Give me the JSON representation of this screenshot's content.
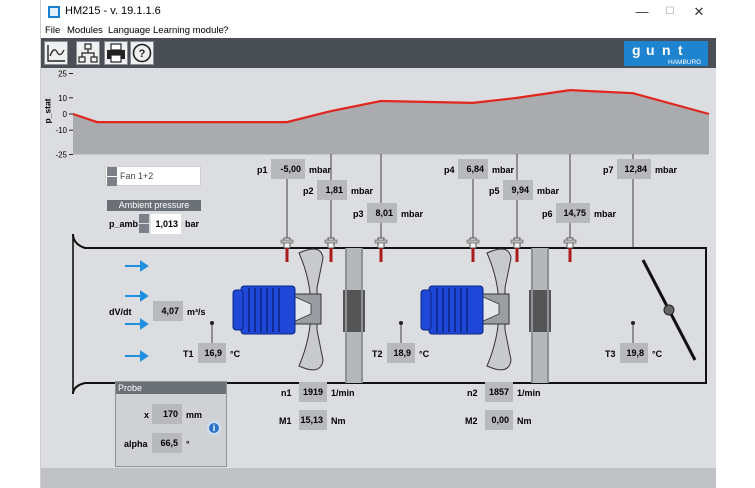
{
  "window": {
    "title": "HM215 - v. 19.1.1.6",
    "minimize": "—",
    "maximize": "☐",
    "close": "✕"
  },
  "menu": [
    "File",
    "Modules",
    "Language",
    "Learning module",
    "?"
  ],
  "toolbar": {
    "buttons": [
      "chart-icon",
      "network-icon",
      "print-icon",
      "help-icon"
    ],
    "logo": "HAMBURG"
  },
  "pressure_chart": {
    "ylabel": "p_stat",
    "ticks": [
      "25",
      "10",
      "0",
      "-10",
      "-25"
    ],
    "ylim": [
      -25,
      25
    ],
    "line_color": "#e0261d",
    "fill_color": "#a9abae",
    "values": [
      0,
      -5.0,
      -5.0,
      1.81,
      8.01,
      6.84,
      9.94,
      14.75,
      12.84,
      0
    ]
  },
  "fan_select": {
    "value": "Fan 1+2"
  },
  "ambient": {
    "header": "Ambient pressure",
    "label": "p_amb",
    "value": "1,013",
    "unit": "bar"
  },
  "sensors": {
    "p1": {
      "label": "p1",
      "value": "-5,00",
      "unit": "mbar"
    },
    "p2": {
      "label": "p2",
      "value": "1,81",
      "unit": "mbar"
    },
    "p3": {
      "label": "p3",
      "value": "8,01",
      "unit": "mbar"
    },
    "p4": {
      "label": "p4",
      "value": "6,84",
      "unit": "mbar"
    },
    "p5": {
      "label": "p5",
      "value": "9,94",
      "unit": "mbar"
    },
    "p6": {
      "label": "p6",
      "value": "14,75",
      "unit": "mbar"
    },
    "p7": {
      "label": "p7",
      "value": "12,84",
      "unit": "mbar"
    }
  },
  "flow": {
    "label": "dV/dt",
    "value": "4,07",
    "unit": "m³/s"
  },
  "temps": {
    "t1": {
      "label": "T1",
      "value": "16,9",
      "unit": "°C"
    },
    "t2": {
      "label": "T2",
      "value": "18,9",
      "unit": "°C"
    },
    "t3": {
      "label": "T3",
      "value": "19,8",
      "unit": "°C"
    }
  },
  "fan1": {
    "n_label": "n1",
    "n_value": "1919",
    "n_unit": "1/min",
    "m_label": "M1",
    "m_value": "15,13",
    "m_unit": "Nm"
  },
  "fan2": {
    "n_label": "n2",
    "n_value": "1857",
    "n_unit": "1/min",
    "m_label": "M2",
    "m_value": "0,00",
    "m_unit": "Nm"
  },
  "probe": {
    "header": "Probe",
    "x_label": "x",
    "x_value": "170",
    "x_unit": "mm",
    "alpha_label": "alpha",
    "alpha_value": "66,5",
    "alpha_unit": "°"
  },
  "colors": {
    "motor": "#1f47d8",
    "toolbar": "#4a4f56",
    "canvas": "#dcdde0",
    "arrow": "#1f8fe0"
  }
}
